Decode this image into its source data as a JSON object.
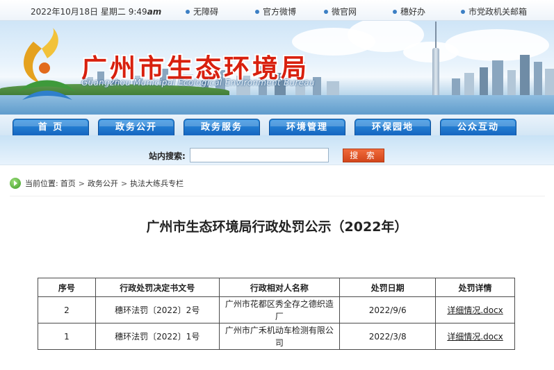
{
  "topbar": {
    "date": "2022年10月18日 星期二",
    "time": "9:49",
    "ampm": "am",
    "links": [
      "无障碍",
      "官方微博",
      "微官网",
      "穗好办",
      "市党政机关邮箱"
    ]
  },
  "banner": {
    "title": "广州市生态环境局",
    "subtitle": "Guangzhou Municipal Ecological Environment Bureau"
  },
  "nav": {
    "tabs": [
      "首 页",
      "政务公开",
      "政务服务",
      "环境管理",
      "环保园地",
      "公众互动"
    ]
  },
  "search": {
    "label": "站内搜索:",
    "value": "",
    "button": "搜 索"
  },
  "breadcrumb": {
    "prefix": "当前位置:",
    "items": [
      "首页",
      "政务公开",
      "执法大练兵专栏"
    ]
  },
  "page": {
    "title": "广州市生态环境局行政处罚公示（2022年）"
  },
  "table": {
    "headers": [
      "序号",
      "行政处罚决定书文号",
      "行政相对人名称",
      "处罚日期",
      "处罚详情"
    ],
    "rows": [
      [
        "2",
        "穗环法罚〔2022〕2号",
        "广州市花都区秀全存之德织造厂",
        "2022/9/6",
        "详细情况.docx"
      ],
      [
        "1",
        "穗环法罚〔2022〕1号",
        "广州市广禾机动车检测有限公司",
        "2022/3/8",
        "详细情况.docx"
      ]
    ]
  },
  "colors": {
    "title_red": "#d8200e",
    "nav_blue": "#1566c0",
    "search_orange": "#d2461b"
  }
}
